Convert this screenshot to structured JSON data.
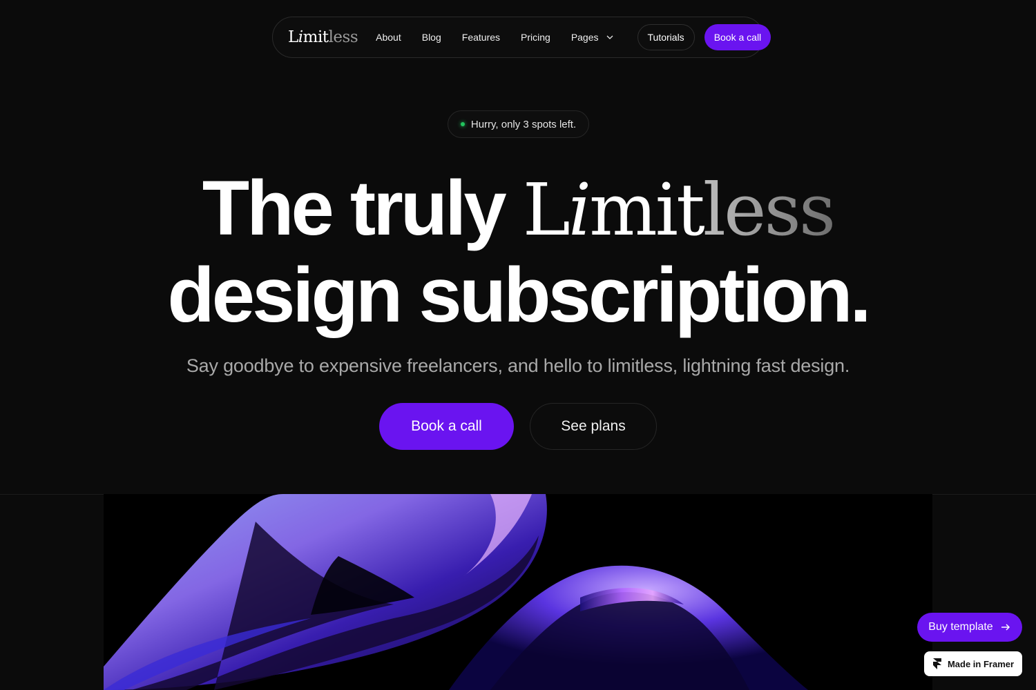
{
  "nav": {
    "logo": {
      "part1": "L",
      "part2": "i",
      "part3": "mit",
      "part4": "less"
    },
    "links": [
      "About",
      "Blog",
      "Features",
      "Pricing",
      "Pages"
    ],
    "tutorials": "Tutorials",
    "book": "Book a call"
  },
  "badge": "Hurry, only 3 spots left.",
  "hero": {
    "line1_prefix": "The truly ",
    "line1_brand": {
      "part1": "L",
      "part2": "i",
      "part3": "mit",
      "part4": "less"
    },
    "line2": "design subscription.",
    "subtitle": "Say goodbye to expensive freelancers, and hello to limitless, lightning fast design.",
    "cta_primary": "Book a call",
    "cta_secondary": "See plans"
  },
  "floating": {
    "buy_template": "Buy template",
    "made_in_framer": "Made in Framer"
  },
  "colors": {
    "accent": "#6a14f0",
    "background": "#0b0b0b",
    "status_dot": "#22c55e"
  },
  "icons": [
    "chevron-down-icon",
    "arrow-right-icon",
    "framer-logo-icon"
  ]
}
